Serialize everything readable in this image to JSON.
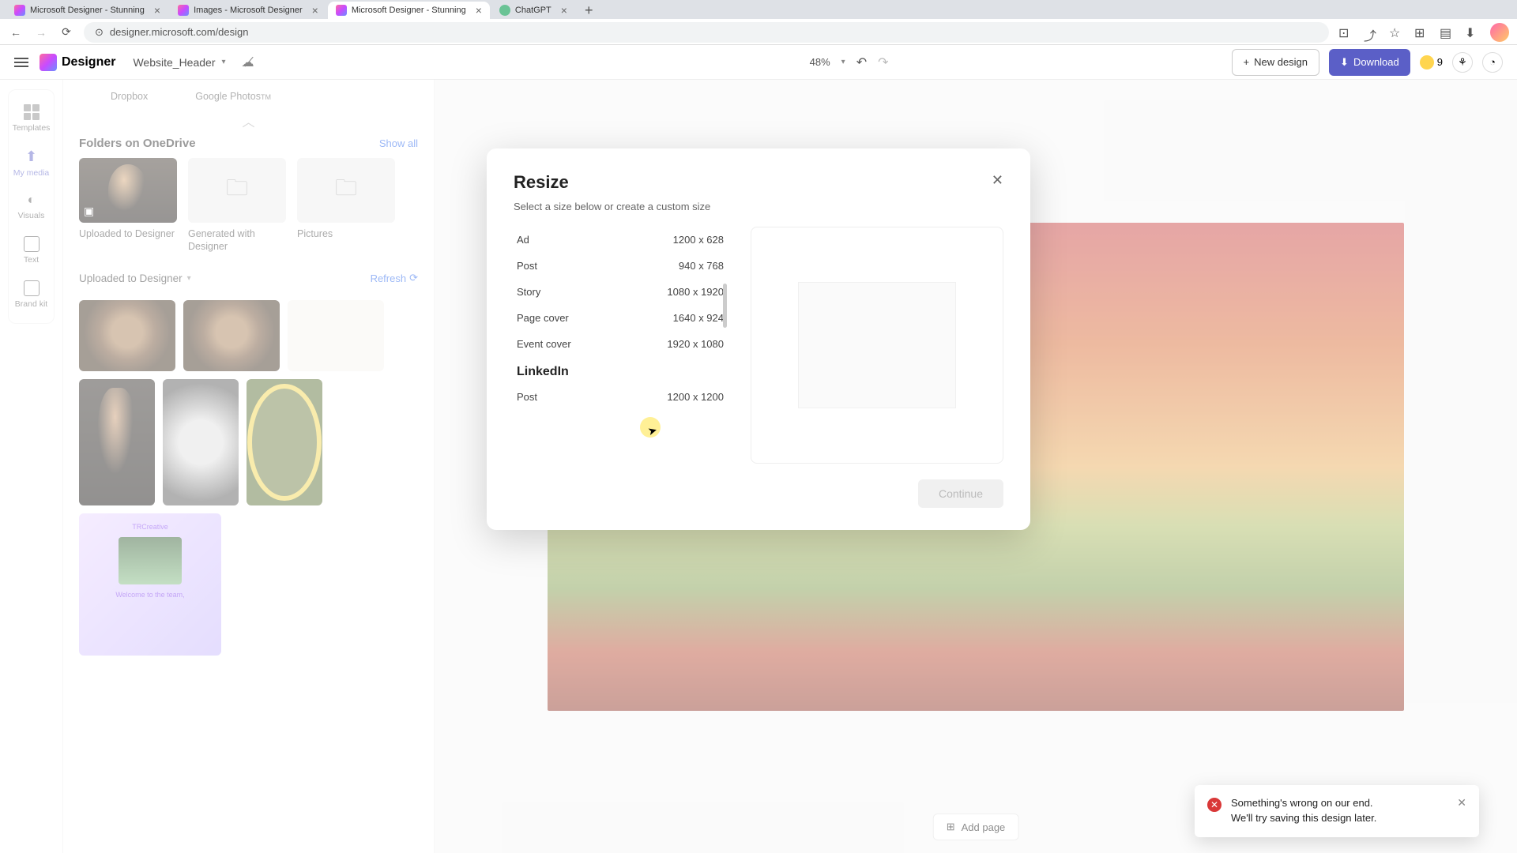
{
  "browser": {
    "tabs": [
      {
        "title": "Microsoft Designer - Stunning"
      },
      {
        "title": "Images - Microsoft Designer"
      },
      {
        "title": "Microsoft Designer - Stunning"
      },
      {
        "title": "ChatGPT"
      }
    ],
    "url": "designer.microsoft.com/design"
  },
  "header": {
    "brand": "Designer",
    "project": "Website_Header",
    "zoom": "48%",
    "new_design": "New design",
    "download": "Download",
    "credits": "9"
  },
  "rail": {
    "templates": "Templates",
    "my_media": "My media",
    "visuals": "Visuals",
    "text": "Text",
    "brand_kit": "Brand kit"
  },
  "panel": {
    "clouds": {
      "dropbox": "Dropbox",
      "gphotos": "Google Photos",
      "tm": "TM"
    },
    "folders_title": "Folders on OneDrive",
    "show_all": "Show all",
    "folders": [
      {
        "label": "Uploaded to Designer"
      },
      {
        "label": "Generated with Designer"
      },
      {
        "label": "Pictures"
      }
    ],
    "uploaded_title": "Uploaded to Designer",
    "refresh": "Refresh",
    "card_brand": "TRCreative",
    "card_welcome": "Welcome to the team,"
  },
  "modal": {
    "title": "Resize",
    "subtitle": "Select a size below or create a custom size",
    "groups": [
      {
        "label": "LinkedIn"
      }
    ],
    "rows": [
      {
        "name": "Ad",
        "dim": "1200 x 628"
      },
      {
        "name": "Post",
        "dim": "940 x 768"
      },
      {
        "name": "Story",
        "dim": "1080 x 1920"
      },
      {
        "name": "Page cover",
        "dim": "1640 x 924"
      },
      {
        "name": "Event cover",
        "dim": "1920 x 1080"
      },
      {
        "name": "Post",
        "dim": "1200 x 1200"
      }
    ],
    "continue": "Continue"
  },
  "toast": {
    "line1": "Something's wrong on our end.",
    "line2": "We'll try saving this design later."
  },
  "footer": {
    "add_page": "Add page"
  }
}
